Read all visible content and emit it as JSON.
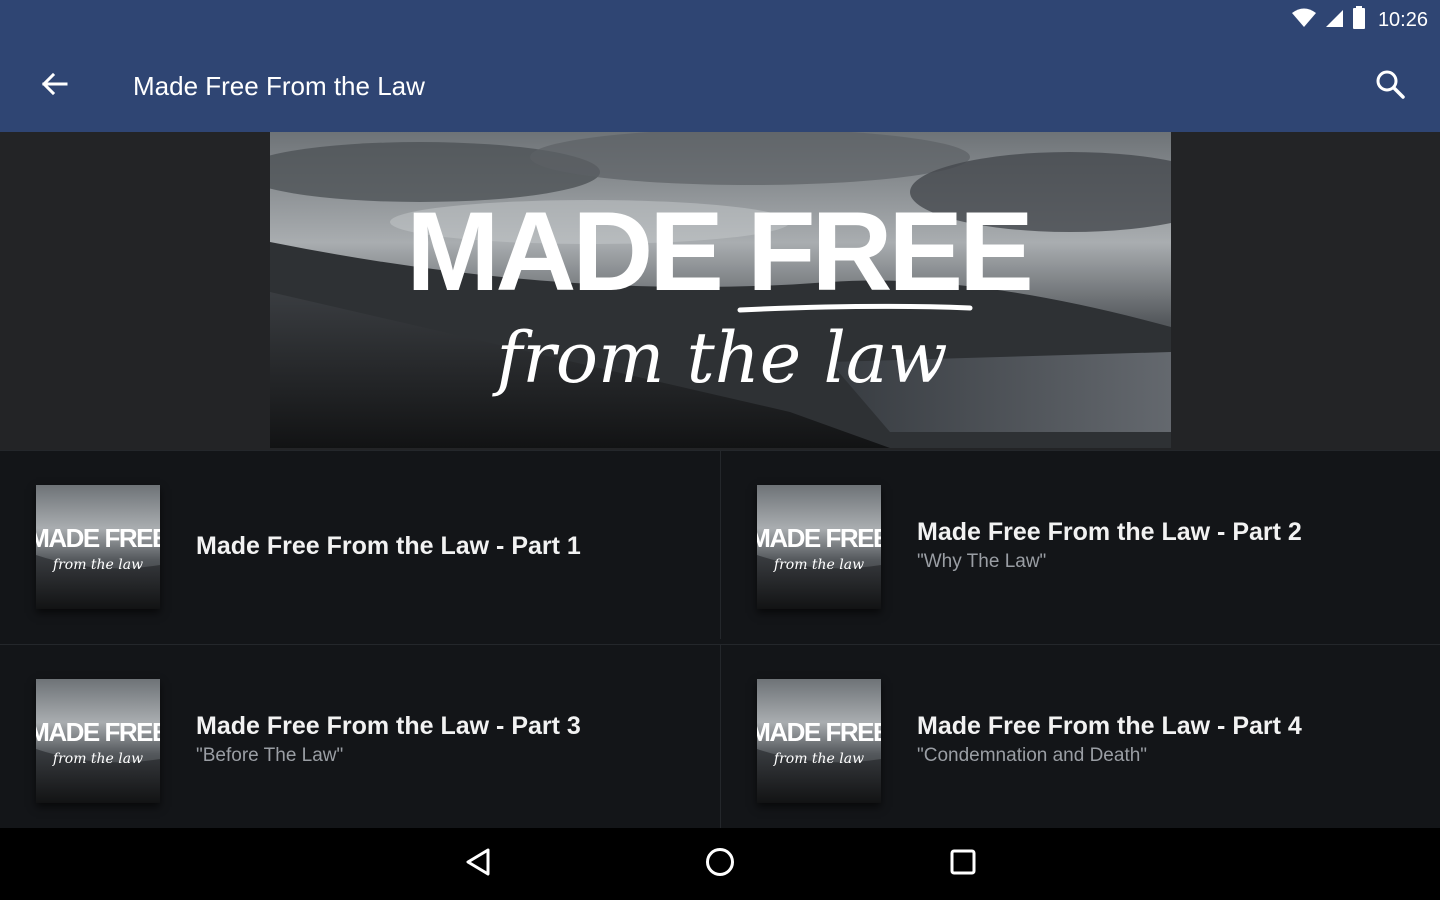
{
  "status_bar": {
    "time": "10:26",
    "icons": [
      "wifi-icon",
      "cell-signal-icon",
      "battery-icon"
    ]
  },
  "app_bar": {
    "title": "Made Free From the Law",
    "back_icon": "arrow-back-icon",
    "search_icon": "search-icon",
    "background_color": "#2f4573"
  },
  "hero": {
    "banner_title": "MADE FREE",
    "banner_subtitle": "from the law"
  },
  "thumbnail": {
    "title": "MADE FREE",
    "subtitle": "from the law"
  },
  "items": [
    {
      "title": "Made Free From the Law - Part 1",
      "subtitle": ""
    },
    {
      "title": "Made Free From the Law - Part 2",
      "subtitle": "\"Why The Law\""
    },
    {
      "title": "Made Free From the Law - Part 3",
      "subtitle": "\"Before The Law\""
    },
    {
      "title": "Made Free From the Law - Part 4",
      "subtitle": "\"Condemnation and Death\""
    }
  ],
  "nav_bar": {
    "icons": [
      "nav-back-icon",
      "nav-home-icon",
      "nav-recents-icon"
    ]
  }
}
